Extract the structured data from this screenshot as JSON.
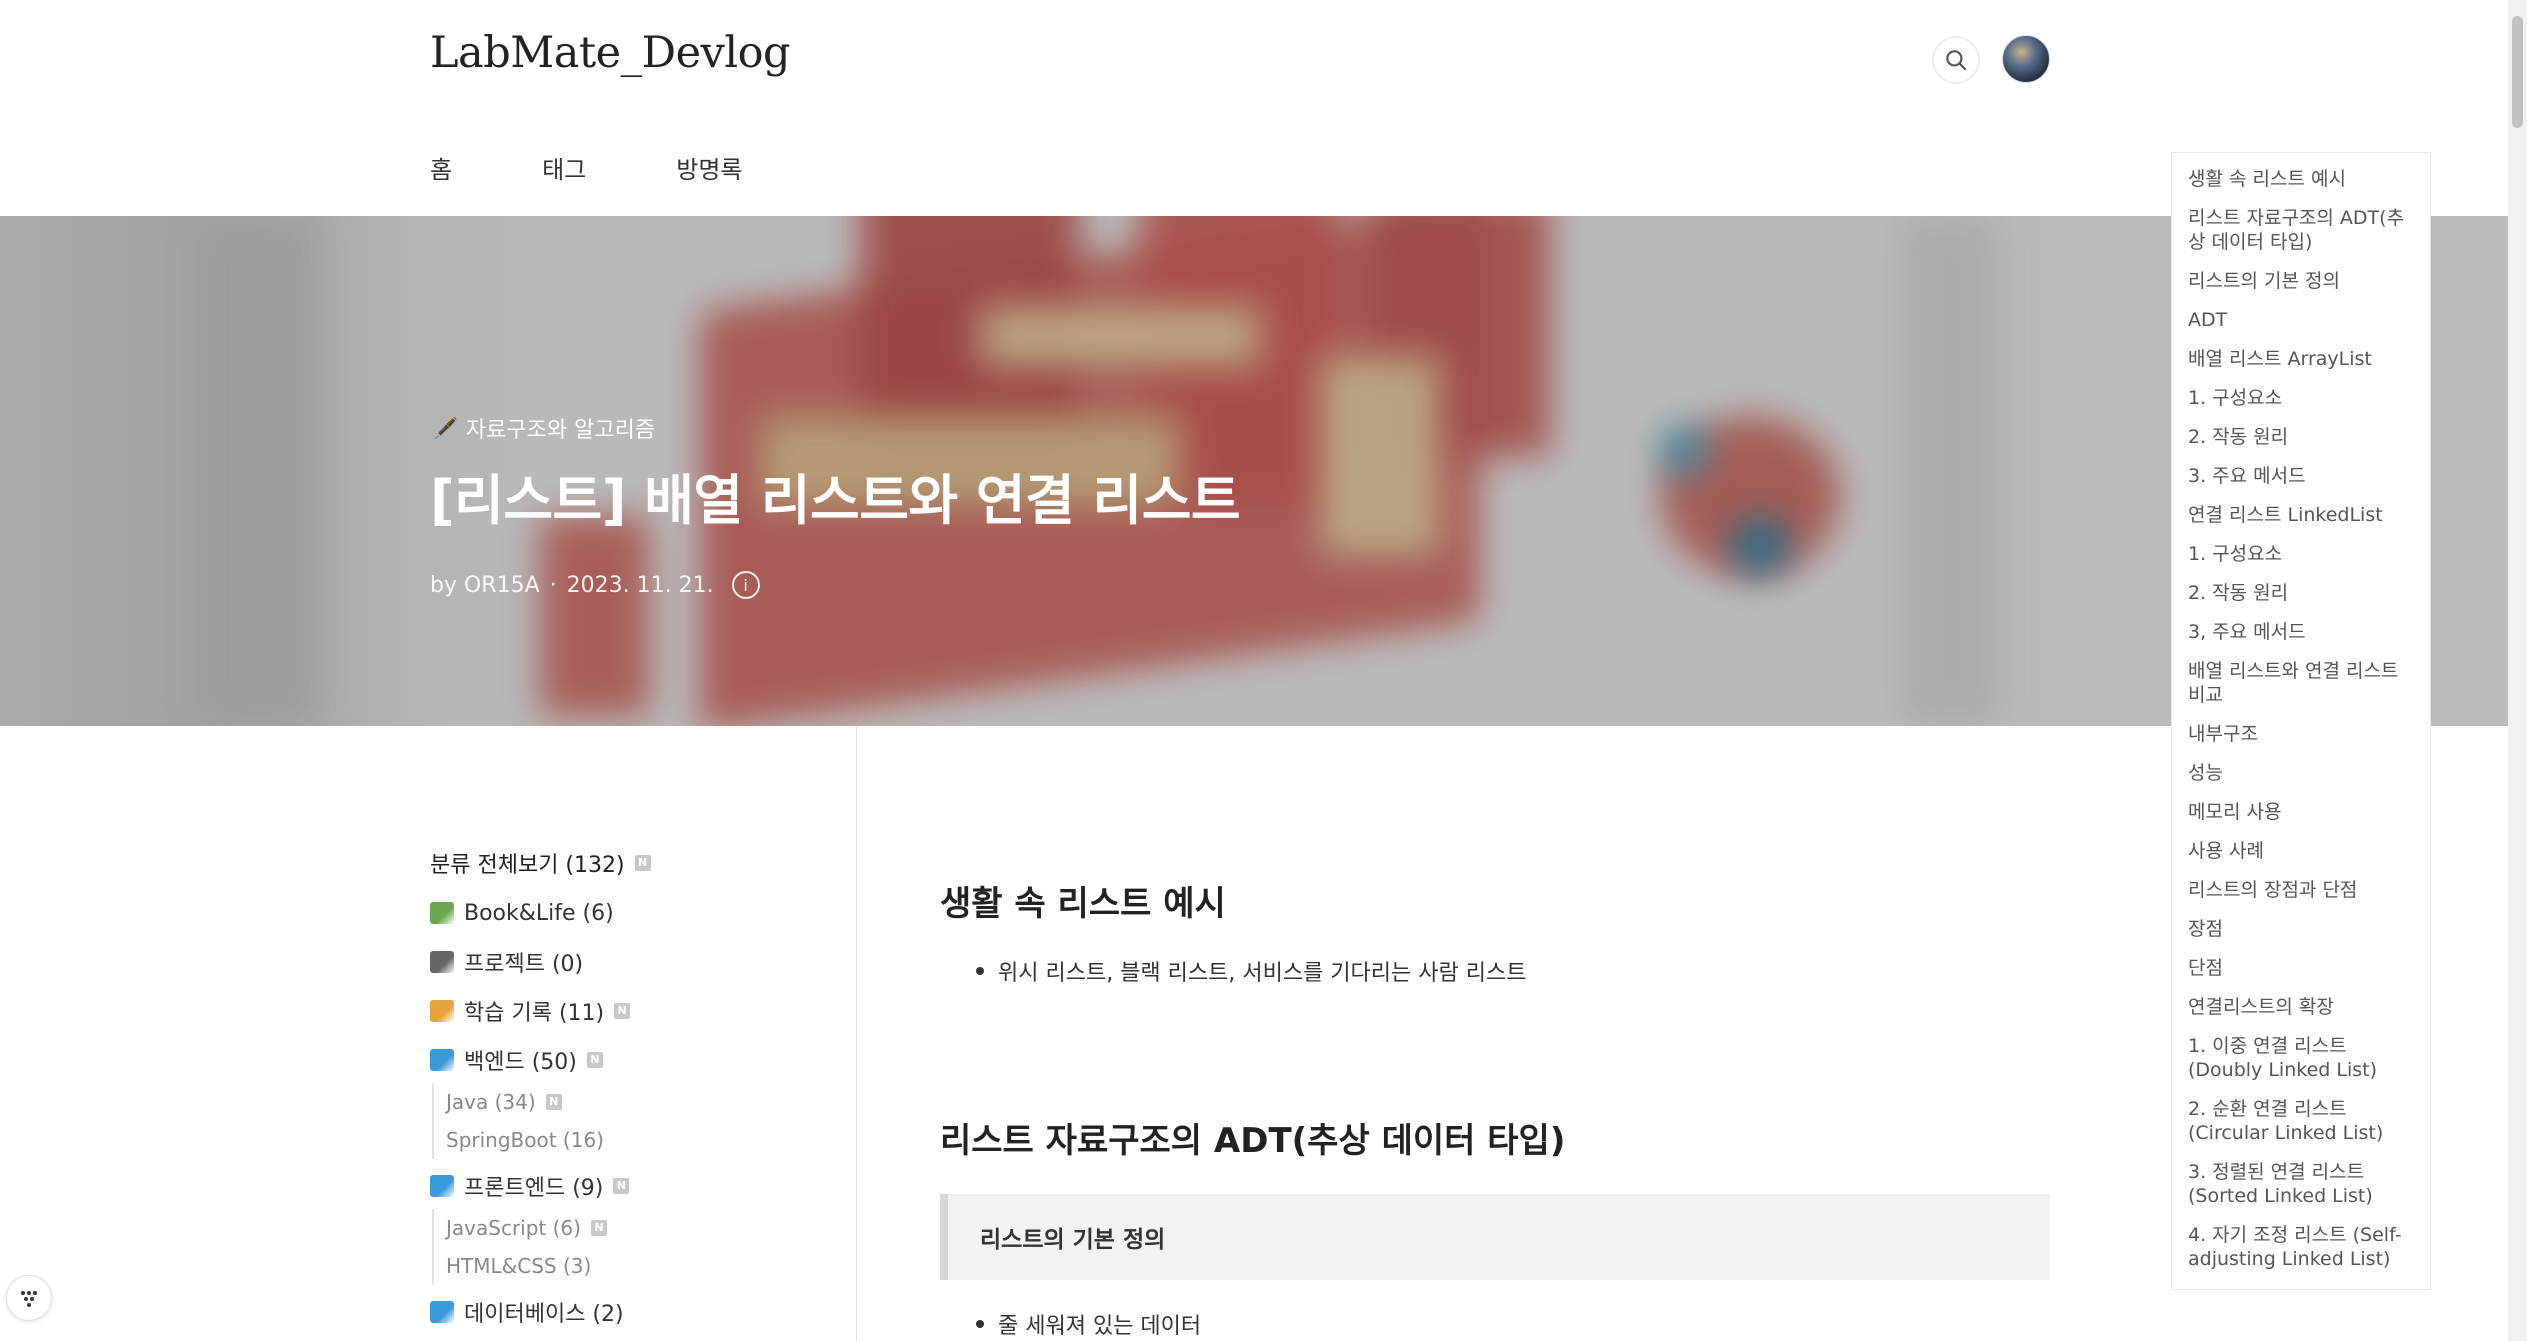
{
  "header": {
    "blog_title": "LabMate_Devlog",
    "nav": [
      "홈",
      "태그",
      "방명록"
    ]
  },
  "hero": {
    "category": "자료구조와 알고리즘",
    "title": "[리스트] 배열 리스트와 연결 리스트",
    "author": "by OR15A",
    "separator": "·",
    "date": "2023. 11. 21.",
    "info_glyph": "i"
  },
  "sidebar": {
    "all_label": "분류 전체보기 (132)",
    "new_badge": "N",
    "categories": [
      {
        "label": "Book&Life (6)",
        "new": false,
        "color": "#6aa84f"
      },
      {
        "label": "프로젝트 (0)",
        "new": false,
        "color": "#666666"
      },
      {
        "label": "학습 기록 (11)",
        "new": true,
        "color": "#e6a23c"
      },
      {
        "label": "백엔드 (50)",
        "new": true,
        "color": "#3a9ad9",
        "children": [
          {
            "label": "Java (34)",
            "new": true
          },
          {
            "label": "SpringBoot (16)",
            "new": false
          }
        ]
      },
      {
        "label": "프론트엔드 (9)",
        "new": true,
        "color": "#3a9ad9",
        "children": [
          {
            "label": "JavaScript (6)",
            "new": true
          },
          {
            "label": "HTML&CSS (3)",
            "new": false
          }
        ]
      },
      {
        "label": "데이터베이스 (2)",
        "new": false,
        "color": "#3a9ad9"
      }
    ]
  },
  "article": {
    "section1_title": "생활 속 리스트 예시",
    "section1_bullet": "위시 리스트, 블랙 리스트, 서비스를 기다리는 사람 리스트",
    "section2_title": "리스트 자료구조의 ADT(추상 데이터 타입)",
    "quote": "리스트의 기본 정의",
    "section2_bullet": "줄 세워져 있는 데이터"
  },
  "toc": [
    "생활 속 리스트 예시",
    "리스트 자료구조의 ADT(추상 데이터 타입)",
    "리스트의 기본 정의",
    "ADT",
    "배열 리스트 ArrayList",
    "1. 구성요소",
    "2. 작동 원리",
    "3. 주요 메서드",
    "연결 리스트 LinkedList",
    "1. 구성요소",
    "2. 작동 원리",
    "3, 주요 메서드",
    "배열 리스트와 연결 리스트 비교",
    "내부구조",
    "성능",
    "메모리 사용",
    "사용 사례",
    "리스트의 장점과 단점",
    "장점",
    "단점",
    "연결리스트의 확장",
    "1. 이중 연결 리스트 (Doubly Linked List)",
    "2. 순환 연결 리스트 (Circular Linked List)",
    "3. 정렬된 연결 리스트 (Sorted Linked List)",
    "4. 자기 조정 리스트 (Self-adjusting Linked List)"
  ]
}
